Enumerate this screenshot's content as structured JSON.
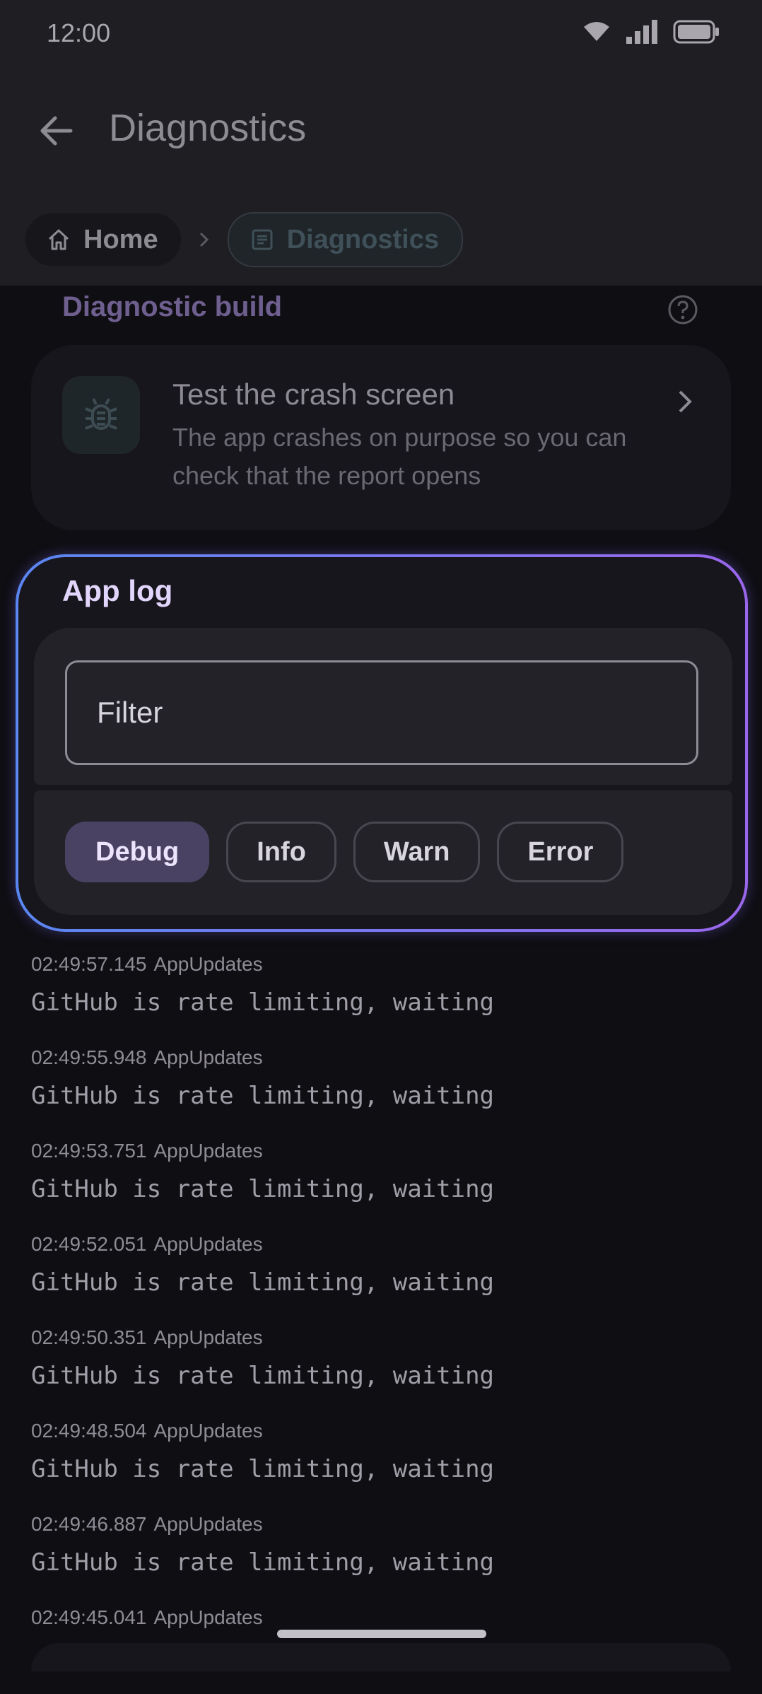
{
  "status_bar": {
    "time": "12:00"
  },
  "app_bar": {
    "title": "Diagnostics",
    "back_icon": "arrow-left-icon"
  },
  "breadcrumbs": [
    {
      "label": "Home",
      "icon": "home-icon"
    },
    {
      "label": "Diagnostics",
      "icon": "document-icon"
    }
  ],
  "diagnostic_build": {
    "section_title": "Diagnostic build",
    "help_icon": "help-circle-icon",
    "crash_card": {
      "title": "Test the crash screen",
      "subtitle": "The app crashes on purpose so you can check that the report opens",
      "icon": "bug-icon"
    }
  },
  "app_log": {
    "title": "App log",
    "filter_placeholder": "Filter",
    "levels": [
      {
        "label": "Debug",
        "selected": true
      },
      {
        "label": "Info",
        "selected": false
      },
      {
        "label": "Warn",
        "selected": false
      },
      {
        "label": "Error",
        "selected": false
      }
    ]
  },
  "log_entries": [
    {
      "time": "02:49:57.145",
      "tag": "AppUpdates",
      "message": "GitHub is rate limiting, waiting"
    },
    {
      "time": "02:49:55.948",
      "tag": "AppUpdates",
      "message": "GitHub is rate limiting, waiting"
    },
    {
      "time": "02:49:53.751",
      "tag": "AppUpdates",
      "message": "GitHub is rate limiting, waiting"
    },
    {
      "time": "02:49:52.051",
      "tag": "AppUpdates",
      "message": "GitHub is rate limiting, waiting"
    },
    {
      "time": "02:49:50.351",
      "tag": "AppUpdates",
      "message": "GitHub is rate limiting, waiting"
    },
    {
      "time": "02:49:48.504",
      "tag": "AppUpdates",
      "message": "GitHub is rate limiting, waiting"
    },
    {
      "time": "02:49:46.887",
      "tag": "AppUpdates",
      "message": "GitHub is rate limiting, waiting"
    },
    {
      "time": "02:49:45.041",
      "tag": "AppUpdates",
      "message": ""
    }
  ],
  "colors": {
    "accent_start": "#5a86f2",
    "accent_end": "#9a67ec",
    "selected_chip": "#4a4262"
  }
}
